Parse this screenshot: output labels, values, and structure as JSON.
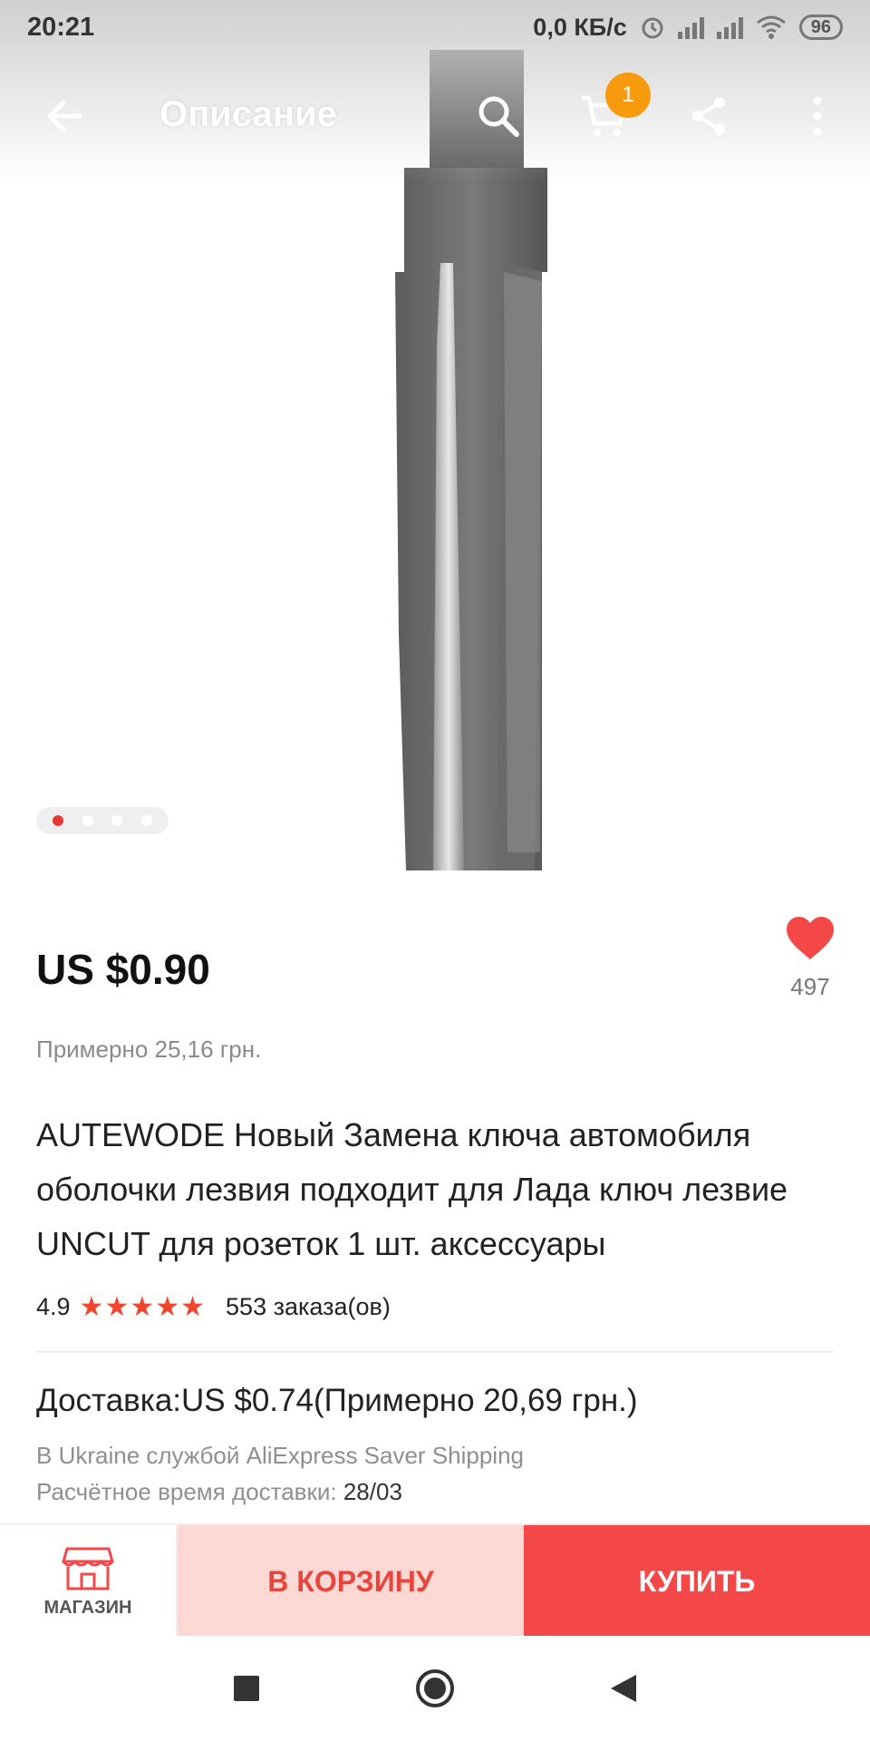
{
  "status_bar": {
    "time": "20:21",
    "network_speed": "0,0 КБ/с",
    "battery": "96"
  },
  "app_bar": {
    "title": "Описание",
    "cart_count": "1"
  },
  "gallery": {
    "image_count": 4,
    "active_index": 0
  },
  "product": {
    "price": "US $0.90",
    "approx_price": "Примерно 25,16 грн.",
    "favorites_count": "497",
    "title": "AUTEWODE Новый Замена ключа автомобиля оболочки лезвия подходит для Лада ключ лезвие UNCUT для розеток 1 шт. аксессуары",
    "rating": "4.9",
    "stars": "★★★★★",
    "orders": "553 заказа(ов)"
  },
  "shipping": {
    "cost": "Доставка:US $0.74(Примерно 20,69 грн.)",
    "method": "В Ukraine службой AliExpress Saver Shipping",
    "time_label": "Расчётное время доставки: ",
    "time_value": "28/03"
  },
  "actions": {
    "store_label": "МАГАЗИН",
    "add_to_cart_label": "В КОРЗИНУ",
    "buy_label": "КУПИТЬ"
  },
  "colors": {
    "accent": "#f44848",
    "cart_bg": "#fdd9d6",
    "badge": "#f89a0e"
  }
}
